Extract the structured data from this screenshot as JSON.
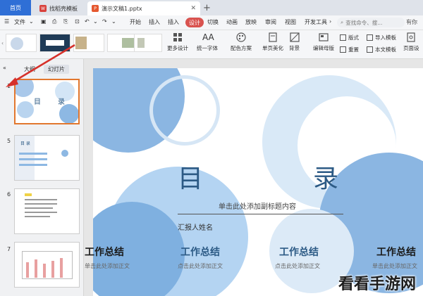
{
  "tabs": {
    "home": "首页",
    "templates": "找稻壳模板",
    "document": "演示文稿1.pptx"
  },
  "menu": {
    "file": "文件",
    "start": "开始",
    "insert": "插入",
    "design": "设计",
    "switch": "切换",
    "animation": "动画",
    "playback": "放映",
    "review": "审阅",
    "view": "视图",
    "dev_tools": "开发工具",
    "search_placeholder": "查找命令、搜...",
    "ai": "有你"
  },
  "ribbon": {
    "more_designs": "更多设计",
    "unify_fonts": "统一字体",
    "color_scheme": "配色方案",
    "beautify": "单页美化",
    "background": "背景",
    "edit_master": "编辑母版",
    "layout": "版式",
    "import_template": "导入模板",
    "reset": "重置",
    "text_template": "本文模板",
    "page_setup": "页面设"
  },
  "left_panel": {
    "tab_outline": "大纲",
    "tab_slides": "幻灯片",
    "collapse_icon": "«",
    "slide_numbers": [
      "1",
      "5",
      "6",
      "7"
    ],
    "thumb1": {
      "title_left": "目",
      "title_right": "录"
    },
    "thumb2": {
      "title": "目 录"
    }
  },
  "slide": {
    "title_left": "目",
    "title_right": "录",
    "subtitle": "单击此处添加副标题内容",
    "reporter": "汇报人姓名"
  },
  "summaries": [
    {
      "title": "工作总结",
      "sub": "单击此处添加正文",
      "color": "#1a1a1a"
    },
    {
      "title": "工作总结",
      "sub": "点击此处添加正文",
      "color": "#2c5a85"
    },
    {
      "title": "工作总结",
      "sub": "点击此处添加正文",
      "color": "#2c5a85"
    },
    {
      "title": "工作总结",
      "sub": "单击此处添加正文",
      "color": "#1a1a1a"
    }
  ],
  "watermark": "看看手游网",
  "colors": {
    "accent_blue": "#2f6fd6",
    "design_red": "#d9534f",
    "selection_orange": "#e2772e",
    "bubble_blue": "#7fb0e0",
    "title_blue": "#2c5a85"
  }
}
